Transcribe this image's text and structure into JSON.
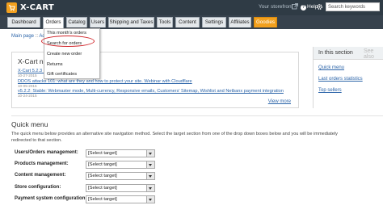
{
  "header": {
    "logo_text": "X-CART",
    "store_link": "Your storefront",
    "help": "Help",
    "help_glyph": "?",
    "search_placeholder": "Search keywords"
  },
  "nav": {
    "tabs": [
      "Dashboard",
      "Orders",
      "Catalog",
      "Users",
      "Shipping and Taxes",
      "Tools",
      "Content",
      "Settings",
      "Affiliates",
      "Goodies"
    ],
    "active_tab": "Orders",
    "accent_color": "#f2a01e"
  },
  "breadcrumb": {
    "first": "Main page",
    "sep": "::",
    "second": "Ad"
  },
  "orders_menu": {
    "items": [
      "This month's orders",
      "Search for orders",
      "Create new order",
      "Returns",
      "Gift certificates"
    ],
    "highlighted": "Search for orders",
    "highlight_color": "#d1262b"
  },
  "news": {
    "title": "X-Cart n",
    "items": [
      {
        "text": "X-Cart 5.2.3 ... running MySQL v.5.6",
        "date": "10-27-2015"
      },
      {
        "text": "DDOS attacks 101: what are they and how to protect your site. Webinar with Cloudflare",
        "date": "10-05-2015"
      },
      {
        "text": "v5.2.2: Stable: Webmaster mode, Multi-currency, Responsive emails, Customers' Sitemap, Wishlist and Netbanx payment integration",
        "date": "10-24-2015"
      }
    ],
    "view_more": "View more"
  },
  "sidebar": {
    "title": "In this section",
    "see_also": "See also",
    "links": [
      "Quick menu",
      "Last orders statistics",
      "Top sellers"
    ]
  },
  "quick_menu": {
    "title": "Quick menu",
    "description": "The quick menu below provides an alternative site navigation method. Select the target section from one of the drop down boxes below and you will be immediately redirected to that section.",
    "rows": [
      {
        "label": "Users/Orders management:",
        "value": "[Select target]"
      },
      {
        "label": "Products management:",
        "value": "[Select target]"
      },
      {
        "label": "Content management:",
        "value": "[Select target]"
      },
      {
        "label": "Store configuration:",
        "value": "[Select target]"
      },
      {
        "label": "Payment system configuration:",
        "value": "[Select target]"
      }
    ]
  }
}
